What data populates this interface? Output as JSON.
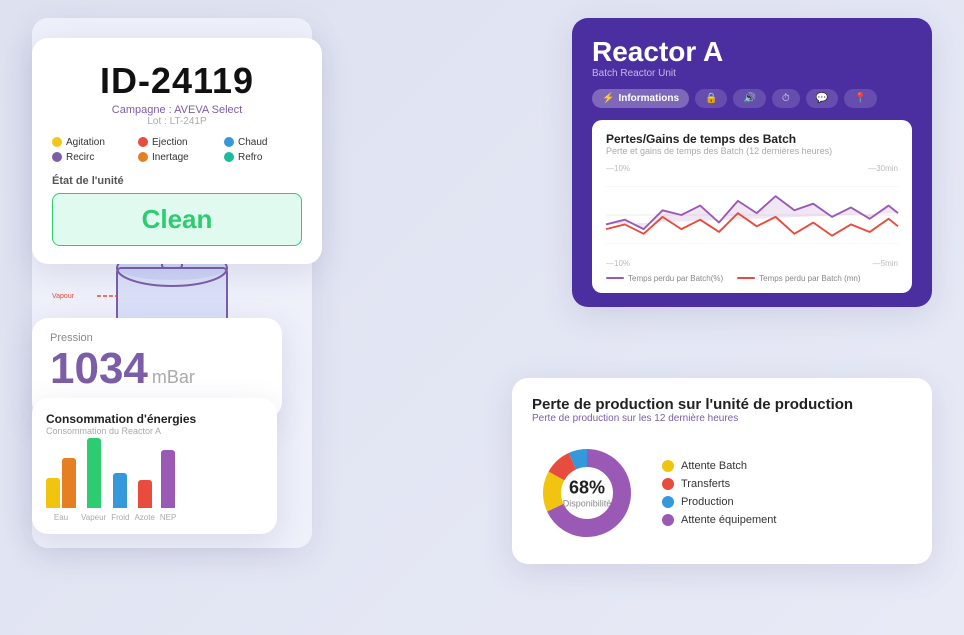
{
  "id_card": {
    "id_number": "ID-24119",
    "campaign": "Campagne : AVEVA Select",
    "lot": "Lot : LT-241P",
    "tags": [
      {
        "label": "Agitation",
        "color": "yellow"
      },
      {
        "label": "Ejection",
        "color": "red"
      },
      {
        "label": "Chaud",
        "color": "blue"
      },
      {
        "label": "Recirc",
        "color": "purple"
      },
      {
        "label": "Inertage",
        "color": "orange"
      },
      {
        "label": "Refro",
        "color": "teal"
      }
    ],
    "etat_label": "État de l'unité",
    "clean_label": "Clean"
  },
  "pression_card": {
    "label": "Pression",
    "value": "1034",
    "unit": "mBar"
  },
  "energy_card": {
    "title": "Consommation d'énergies",
    "subtitle": "Consommation du Reactor A",
    "bars": [
      {
        "label": "Eau",
        "colors": [
          "#f1c40f",
          "#e67e22"
        ],
        "heights": [
          30,
          50
        ]
      },
      {
        "label": "Vapeur",
        "colors": [
          "#2ecc71"
        ],
        "heights": [
          70
        ]
      },
      {
        "label": "Froid",
        "colors": [
          "#3498db"
        ],
        "heights": [
          35
        ]
      },
      {
        "label": "Azote",
        "colors": [
          "#e74c3c"
        ],
        "heights": [
          28
        ]
      },
      {
        "label": "NEP",
        "colors": [
          "#9b59b6"
        ],
        "heights": [
          58
        ]
      }
    ]
  },
  "reactor_a": {
    "title": "Reactor A",
    "subtitle": "Batch Reactor Unit",
    "tabs": [
      {
        "label": "Informations",
        "icon": "⚡",
        "active": true
      },
      {
        "label": "",
        "icon": "🔒"
      },
      {
        "label": "",
        "icon": "🔊"
      },
      {
        "label": "",
        "icon": "⏱"
      },
      {
        "label": "",
        "icon": "💬"
      },
      {
        "label": "",
        "icon": "📍"
      }
    ],
    "chart": {
      "title": "Pertes/Gains de temps des Batch",
      "subtitle": "Perte et gains de temps des Batch (12 dernières heures)",
      "left_top": "—10%",
      "right_top": "—30min",
      "left_bottom": "—10%",
      "right_bottom": "—5min",
      "legend": [
        {
          "label": "Temps perdu par Batch(%)",
          "color": "#9b59b6"
        },
        {
          "label": "Temps perdu par Batch (mn)",
          "color": "#e74c3c"
        }
      ]
    }
  },
  "production_card": {
    "title": "Perte de production sur l'unité de production",
    "subtitle": "Perte de production sur les 12 dernière heures",
    "donut_pct": "68%",
    "donut_label": "Disponibilité",
    "legend": [
      {
        "label": "Attente Batch",
        "color": "#f1c40f"
      },
      {
        "label": "Transferts",
        "color": "#e74c3c"
      },
      {
        "label": "Production",
        "color": "#3498db"
      },
      {
        "label": "Attente équipement",
        "color": "#9b59b6"
      }
    ],
    "donut_segments": [
      {
        "color": "#f1c40f",
        "pct": 15
      },
      {
        "color": "#e74c3c",
        "pct": 10
      },
      {
        "color": "#3498db",
        "pct": 7
      },
      {
        "color": "#9b59b6",
        "pct": 68
      }
    ]
  }
}
